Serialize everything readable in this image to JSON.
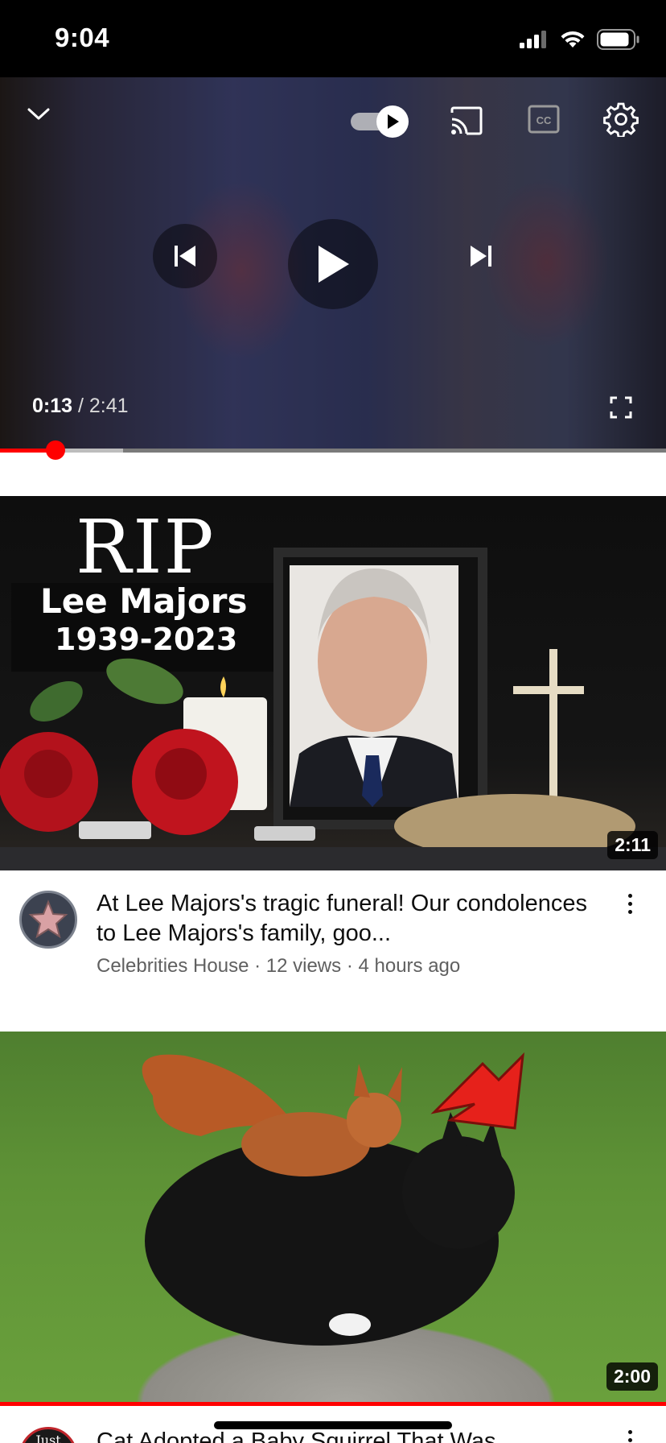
{
  "status_bar": {
    "time": "9:04"
  },
  "player": {
    "current_time": "0:13",
    "separator": " / ",
    "total_time": "2:41",
    "progress_fraction": 0.083,
    "buffered_fraction": 0.185,
    "autoplay_on": true,
    "icons": [
      "collapse-chevron-icon",
      "autoplay-toggle-icon",
      "cast-icon",
      "captions-icon",
      "settings-gear-icon",
      "previous-icon",
      "play-icon",
      "next-icon",
      "fullscreen-icon"
    ]
  },
  "videos": [
    {
      "thumbnail_text": {
        "rip": "RIP",
        "name": "Lee Majors",
        "years": "1939-2023"
      },
      "duration": "2:11",
      "title": "At Lee Majors's tragic funeral! Our condolences to Lee Majors's family, goo...",
      "channel": "Celebrities House",
      "views": "12 views",
      "age": "4 hours ago"
    },
    {
      "duration": "2:00",
      "title": "Cat Adopted a Baby Squirrel That Was",
      "channel_avatar_text": "Just"
    }
  ],
  "colors": {
    "accent": "#ff0000",
    "text_primary": "#0f0f0f",
    "text_secondary": "#606060"
  }
}
